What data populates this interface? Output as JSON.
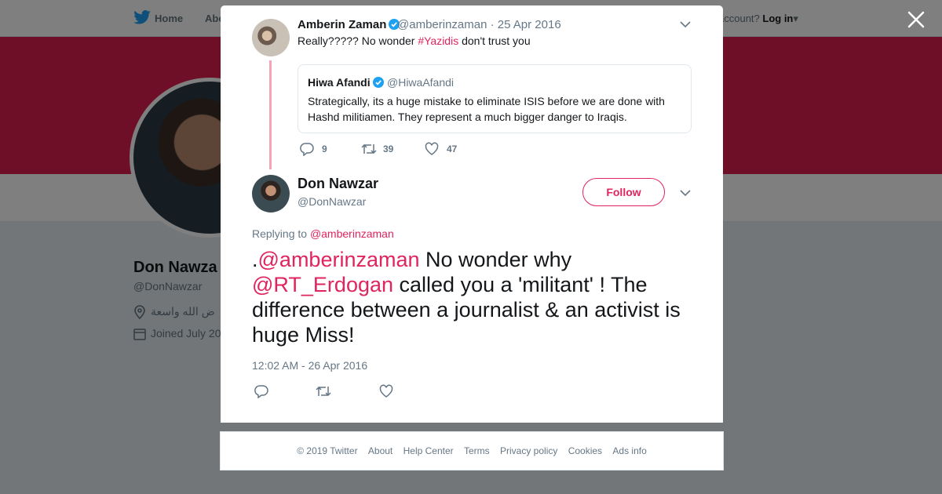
{
  "background": {
    "nav": {
      "home": "Home",
      "about": "Abo",
      "account_text": "account?",
      "login": "Log in"
    },
    "profile": {
      "name": "Don Nawza",
      "handle": "@DonNawzar",
      "location": "ض الله واسعة",
      "joined": "Joined July 20"
    },
    "banner_color": "#dd1e4e"
  },
  "modal": {
    "parent_tweet": {
      "author_name": "Amberin Zaman",
      "author_handle_date": "@amberinzaman · 25 Apr 2016",
      "text_before": "Really????? No wonder ",
      "hashtag": "#Yazidis",
      "text_after": " don't trust you",
      "quote": {
        "author_name": "Hiwa Afandi",
        "author_handle": "@HiwaAfandi",
        "text": "Strategically, its a huge mistake to eliminate ISIS before we are done with Hashd militiamen. They represent a much bigger danger to Iraqis."
      },
      "stats": {
        "replies": "9",
        "retweets": "39",
        "likes": "47"
      }
    },
    "main_tweet": {
      "author_name": "Don Nawzar",
      "author_handle": "@DonNawzar",
      "follow_label": "Follow",
      "replying_label": "Replying to ",
      "replying_to": "@amberinzaman",
      "text_prefix": ".",
      "mention_1": "@amberinzaman",
      "text_mid": " No wonder why ",
      "mention_2": "@RT_Erdogan",
      "text_end": " called you a 'militant' ! The difference between a journalist & an activist is huge Miss!",
      "timestamp": "12:02 AM - 26 Apr 2016"
    }
  },
  "footer": {
    "copyright": "© 2019 Twitter",
    "links": [
      "About",
      "Help Center",
      "Terms",
      "Privacy policy",
      "Cookies",
      "Ads info"
    ]
  },
  "colors": {
    "accent": "#e0245e",
    "verified": "#1da1f2",
    "muted": "#657786"
  },
  "icons": [
    "twitter-bird-icon",
    "close-icon",
    "verified-badge-icon",
    "chevron-down-icon",
    "reply-icon",
    "retweet-icon",
    "like-icon",
    "location-pin-icon",
    "calendar-icon"
  ]
}
